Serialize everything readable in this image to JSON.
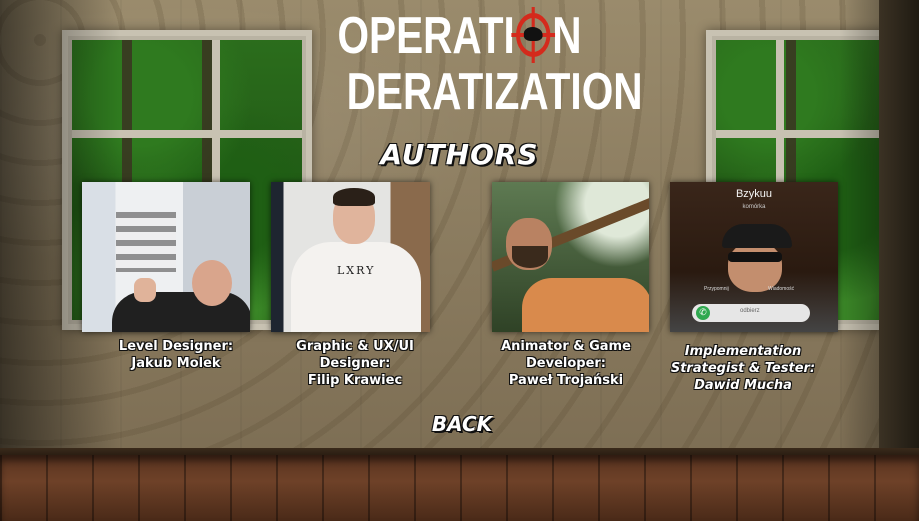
{
  "game": {
    "title_line1_prefix": "OPERATI",
    "title_line1_suffix": "N",
    "title_line2": "DERATIZATION",
    "logo_icon": "crosshair-rat-icon",
    "accent_color": "#d42a1c"
  },
  "screen": {
    "heading": "AUTHORS",
    "back_label": "BACK"
  },
  "authors": [
    {
      "role": "Level Designer:",
      "name": "Jakub Molek"
    },
    {
      "role": "Graphic & UX/UI Designer:",
      "name": "Filip Krawiec",
      "photo_text": "LXRY"
    },
    {
      "role": "Animator & Game Developer:",
      "name": "Paweł Trojański"
    },
    {
      "role": "Implementation Strategist & Tester:",
      "name": "Dawid Mucha",
      "photo_caller": "Bzykuu",
      "photo_caller_sub": "komórka",
      "photo_btn_left": "Przypomnij",
      "photo_btn_right": "Wiadomość",
      "photo_answer": "odbierz"
    }
  ]
}
